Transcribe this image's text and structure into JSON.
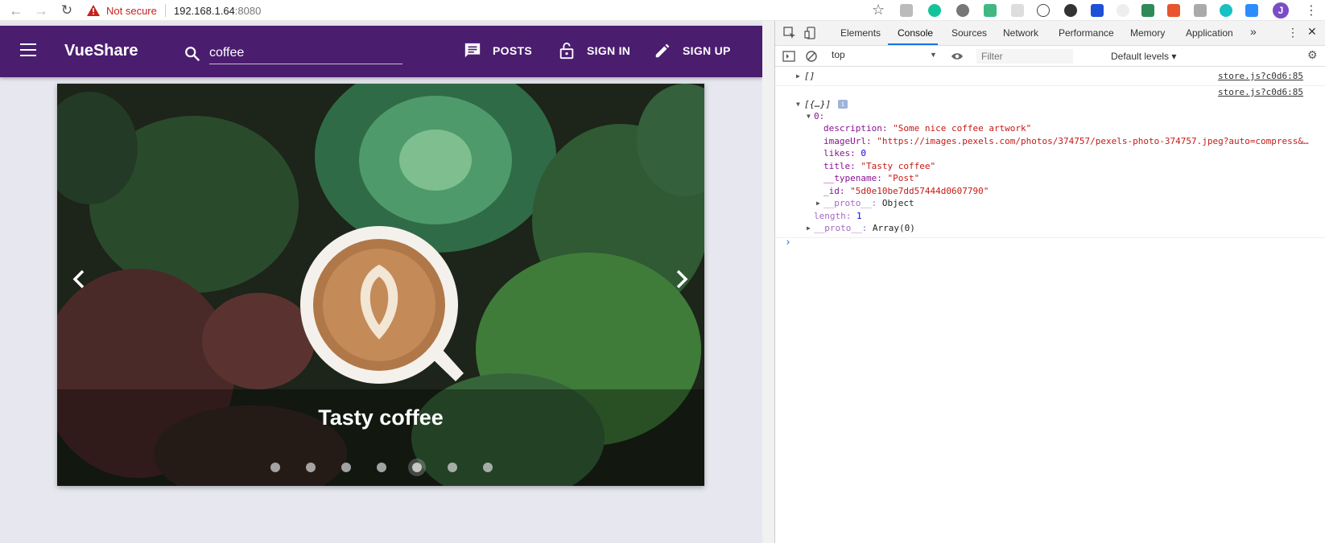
{
  "browser": {
    "security_label": "Not secure",
    "url_host": "192.168.1.64",
    "url_port": ":8080",
    "profile_initial": "J",
    "icons": [
      "back-arrow-icon",
      "forward-arrow-icon",
      "reload-icon",
      "warning-icon",
      "bookmark-star-icon",
      "extension-icons",
      "profile-avatar",
      "kebab-menu-icon"
    ]
  },
  "app": {
    "brand": "VueShare",
    "search": {
      "value": "coffee"
    },
    "nav": {
      "posts": "POSTS",
      "sign_in": "SIGN IN",
      "sign_up": "SIGN UP"
    },
    "colors": {
      "appbar": "#4b1d6f",
      "page_bg": "#e7e7ef"
    }
  },
  "carousel": {
    "caption": "Tasty coffee",
    "slide_count": 7,
    "active_index": 4
  },
  "devtools": {
    "tabs": [
      "Elements",
      "Console",
      "Sources",
      "Network",
      "Performance",
      "Memory",
      "Application"
    ],
    "active_tab": "Console",
    "more_tabs": "»",
    "context": "top",
    "filter_placeholder": "Filter",
    "levels": "Default levels ▾",
    "console": {
      "line1": "[]",
      "line1_source": "store.js?c0d6:85",
      "line2_source": "store.js?c0d6:85",
      "line2_summary": "[{…}]",
      "index_key": "0:",
      "desc_key": "description:",
      "desc_val": "\"Some nice coffee artwork\"",
      "img_key": "imageUrl:",
      "img_val": "\"https://images.pexels.com/photos/374757/pexels-photo-374757.jpeg?auto=compress&…",
      "likes_key": "likes:",
      "likes_val": "0",
      "title_key": "title:",
      "title_val": "\"Tasty coffee\"",
      "typename_key": "__typename:",
      "typename_val": "\"Post\"",
      "id_key": "_id:",
      "id_val": "\"5d0e10be7dd57444d0607790\"",
      "proto_key": "__proto__:",
      "proto_val": "Object",
      "length_key": "length:",
      "length_val": "1",
      "proto2_key": "__proto__:",
      "proto2_val": "Array(0)",
      "prompt": "›"
    }
  }
}
